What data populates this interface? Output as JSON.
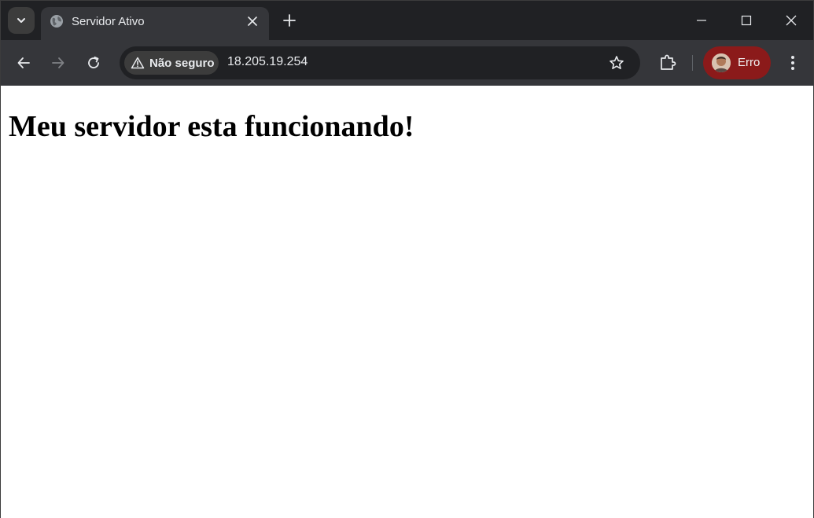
{
  "browser": {
    "tab": {
      "title": "Servidor Ativo"
    },
    "address_bar": {
      "security_label": "Não seguro",
      "url": "18.205.19.254"
    },
    "profile": {
      "label": "Erro",
      "color": "#8b1a1a"
    }
  },
  "page": {
    "heading": "Meu servidor esta funcionando!"
  }
}
